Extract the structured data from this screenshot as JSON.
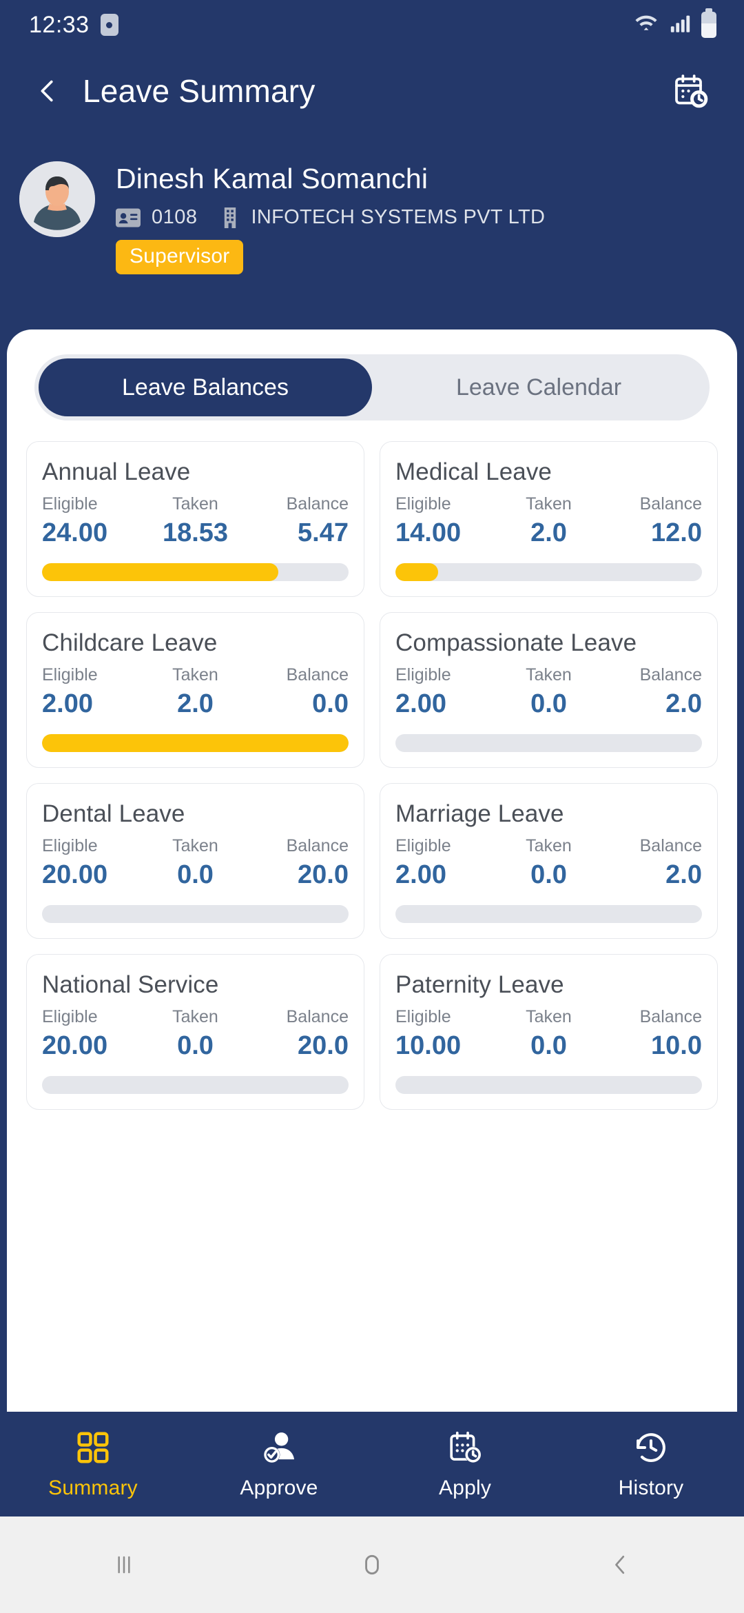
{
  "status_bar": {
    "time": "12:33",
    "alarm_icon": "alarm-icon",
    "wifi_icon": "wifi-icon",
    "signal_icon": "cellular-signal-icon",
    "battery_icon": "battery-icon"
  },
  "app_bar": {
    "back_icon": "back-chevron-icon",
    "title": "Leave Summary",
    "calendar_icon": "calendar-clock-icon"
  },
  "profile": {
    "avatar_icon": "avatar",
    "name": "Dinesh Kamal Somanchi",
    "id_icon": "id-card-icon",
    "employee_id": "0108",
    "company_icon": "building-icon",
    "company": "INFOTECH SYSTEMS PVT LTD",
    "role_badge": "Supervisor",
    "badge_color": "#fcb813"
  },
  "tabs": [
    {
      "label": "Leave Balances",
      "active": true
    },
    {
      "label": "Leave Calendar",
      "active": false
    }
  ],
  "columns": {
    "eligible": "Eligible",
    "taken": "Taken",
    "balance": "Balance"
  },
  "leave_cards": [
    {
      "title": "Annual Leave",
      "eligible": "24.00",
      "taken": "18.53",
      "balance": "5.47",
      "progress": 77
    },
    {
      "title": "Medical Leave",
      "eligible": "14.00",
      "taken": "2.0",
      "balance": "12.0",
      "progress": 14
    },
    {
      "title": "Childcare Leave",
      "eligible": "2.00",
      "taken": "2.0",
      "balance": "0.0",
      "progress": 100
    },
    {
      "title": "Compassionate Leave",
      "eligible": "2.00",
      "taken": "0.0",
      "balance": "2.0",
      "progress": 0
    },
    {
      "title": "Dental Leave",
      "eligible": "20.00",
      "taken": "0.0",
      "balance": "20.0",
      "progress": 0
    },
    {
      "title": "Marriage Leave",
      "eligible": "2.00",
      "taken": "0.0",
      "balance": "2.0",
      "progress": 0
    },
    {
      "title": "National Service",
      "eligible": "20.00",
      "taken": "0.0",
      "balance": "20.0",
      "progress": 0
    },
    {
      "title": "Paternity Leave",
      "eligible": "10.00",
      "taken": "0.0",
      "balance": "10.0",
      "progress": 0
    }
  ],
  "bottom_nav": [
    {
      "label": "Summary",
      "icon": "grid-icon",
      "active": true
    },
    {
      "label": "Approve",
      "icon": "person-check-icon",
      "active": false
    },
    {
      "label": "Apply",
      "icon": "calendar-clock-icon",
      "active": false
    },
    {
      "label": "History",
      "icon": "clock-history-icon",
      "active": false
    }
  ],
  "system_bar": [
    {
      "icon": "recent-apps-icon"
    },
    {
      "icon": "home-icon"
    },
    {
      "icon": "back-icon"
    }
  ],
  "theme": {
    "navy": "#24386a",
    "amber": "#fcc409",
    "value_blue": "#31659e"
  }
}
